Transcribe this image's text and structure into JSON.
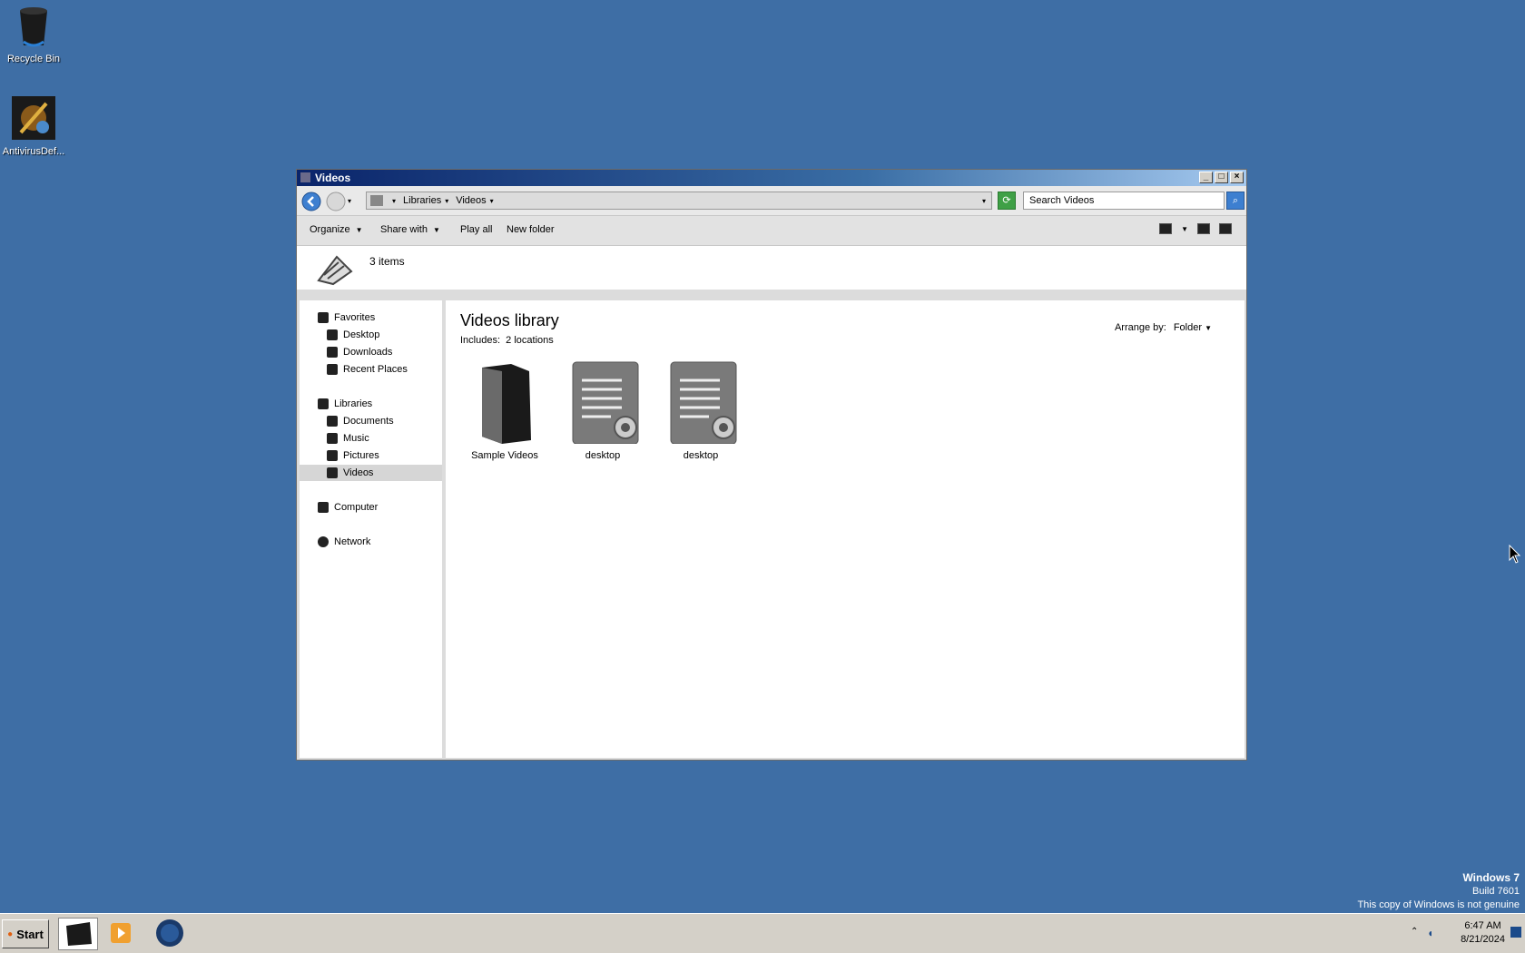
{
  "desktop": {
    "icons": [
      {
        "label": "Recycle Bin",
        "icon": "recycle-bin-icon"
      },
      {
        "label": "AntivirusDef...",
        "icon": "antivirus-icon"
      }
    ],
    "watermark": {
      "line1": "Windows 7",
      "line2": "Build 7601",
      "line3": "This copy of Windows is not genuine"
    }
  },
  "window": {
    "title": "Videos",
    "address": {
      "crumbs": [
        "Libraries",
        "Videos"
      ]
    },
    "search": {
      "placeholder": "Search Videos"
    },
    "toolbar": {
      "organize": "Organize",
      "share_with": "Share with",
      "play_all": "Play all",
      "new_folder": "New folder"
    },
    "details": {
      "count": "3 items"
    },
    "nav": {
      "favorites": "Favorites",
      "desktop": "Desktop",
      "downloads": "Downloads",
      "recent_places": "Recent Places",
      "libraries": "Libraries",
      "documents": "Documents",
      "music": "Music",
      "pictures": "Pictures",
      "videos": "Videos",
      "computer": "Computer",
      "network": "Network"
    },
    "content": {
      "title": "Videos library",
      "includes_label": "Includes:",
      "includes_link": "2 locations",
      "arrange_label": "Arrange by:",
      "arrange_value": "Folder",
      "files": [
        {
          "label": "Sample Videos",
          "icon": "folder-icon"
        },
        {
          "label": "desktop",
          "icon": "config-file-icon"
        },
        {
          "label": "desktop",
          "icon": "config-file-icon"
        }
      ]
    }
  },
  "taskbar": {
    "start": "Start",
    "clock": {
      "time": "6:47 AM",
      "date": "8/21/2024"
    }
  },
  "colors": {
    "desktop": "#3e6ea5",
    "title_start": "#0a246a",
    "title_end": "#a6caf0"
  }
}
